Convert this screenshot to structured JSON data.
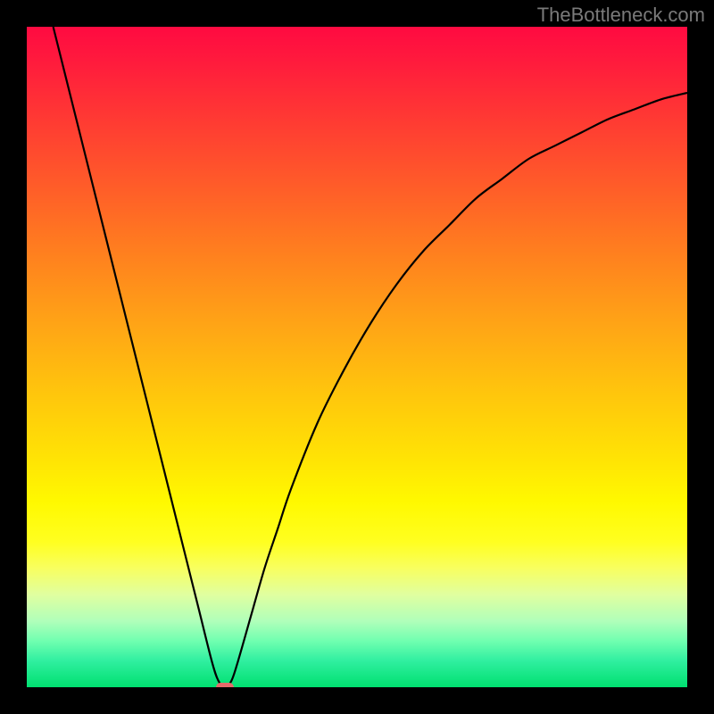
{
  "watermark": "TheBottleneck.com",
  "chart_data": {
    "type": "line",
    "title": "",
    "xlabel": "",
    "ylabel": "",
    "xlim": [
      0,
      100
    ],
    "ylim": [
      0,
      100
    ],
    "grid": false,
    "series": [
      {
        "name": "bottleneck-curve",
        "x": [
          4,
          6,
          8,
          10,
          12,
          14,
          16,
          18,
          20,
          22,
          24,
          26,
          28,
          29,
          30,
          31,
          32,
          34,
          36,
          38,
          40,
          44,
          48,
          52,
          56,
          60,
          64,
          68,
          72,
          76,
          80,
          84,
          88,
          92,
          96,
          100
        ],
        "y": [
          100,
          92,
          84,
          76,
          68,
          60,
          52,
          44,
          36,
          28,
          20,
          12,
          4,
          1,
          0,
          1,
          4,
          11,
          18,
          24,
          30,
          40,
          48,
          55,
          61,
          66,
          70,
          74,
          77,
          80,
          82,
          84,
          86,
          87.5,
          89,
          90
        ]
      }
    ],
    "annotations": [
      {
        "name": "minimum-marker",
        "x": 30,
        "y": 0,
        "color": "#e56a6a"
      }
    ],
    "background": {
      "type": "vertical-gradient",
      "stops": [
        {
          "pos": 0,
          "color": "#ff0a41"
        },
        {
          "pos": 50,
          "color": "#ffb010"
        },
        {
          "pos": 75,
          "color": "#ffff20"
        },
        {
          "pos": 100,
          "color": "#00e070"
        }
      ]
    }
  }
}
